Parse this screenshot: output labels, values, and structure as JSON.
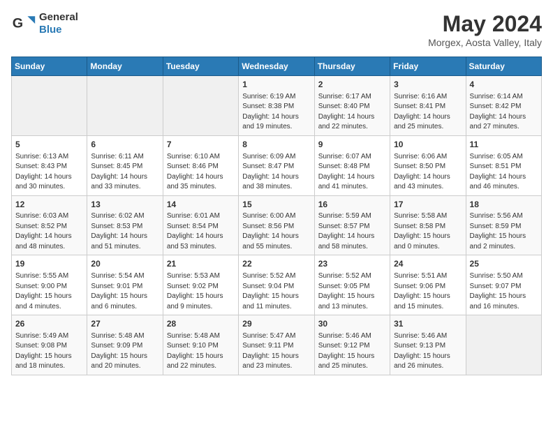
{
  "logo": {
    "line1": "General",
    "line2": "Blue"
  },
  "title": "May 2024",
  "location": "Morgex, Aosta Valley, Italy",
  "days_header": [
    "Sunday",
    "Monday",
    "Tuesday",
    "Wednesday",
    "Thursday",
    "Friday",
    "Saturday"
  ],
  "weeks": [
    [
      {
        "day": "",
        "info": ""
      },
      {
        "day": "",
        "info": ""
      },
      {
        "day": "",
        "info": ""
      },
      {
        "day": "1",
        "info": "Sunrise: 6:19 AM\nSunset: 8:38 PM\nDaylight: 14 hours\nand 19 minutes."
      },
      {
        "day": "2",
        "info": "Sunrise: 6:17 AM\nSunset: 8:40 PM\nDaylight: 14 hours\nand 22 minutes."
      },
      {
        "day": "3",
        "info": "Sunrise: 6:16 AM\nSunset: 8:41 PM\nDaylight: 14 hours\nand 25 minutes."
      },
      {
        "day": "4",
        "info": "Sunrise: 6:14 AM\nSunset: 8:42 PM\nDaylight: 14 hours\nand 27 minutes."
      }
    ],
    [
      {
        "day": "5",
        "info": "Sunrise: 6:13 AM\nSunset: 8:43 PM\nDaylight: 14 hours\nand 30 minutes."
      },
      {
        "day": "6",
        "info": "Sunrise: 6:11 AM\nSunset: 8:45 PM\nDaylight: 14 hours\nand 33 minutes."
      },
      {
        "day": "7",
        "info": "Sunrise: 6:10 AM\nSunset: 8:46 PM\nDaylight: 14 hours\nand 35 minutes."
      },
      {
        "day": "8",
        "info": "Sunrise: 6:09 AM\nSunset: 8:47 PM\nDaylight: 14 hours\nand 38 minutes."
      },
      {
        "day": "9",
        "info": "Sunrise: 6:07 AM\nSunset: 8:48 PM\nDaylight: 14 hours\nand 41 minutes."
      },
      {
        "day": "10",
        "info": "Sunrise: 6:06 AM\nSunset: 8:50 PM\nDaylight: 14 hours\nand 43 minutes."
      },
      {
        "day": "11",
        "info": "Sunrise: 6:05 AM\nSunset: 8:51 PM\nDaylight: 14 hours\nand 46 minutes."
      }
    ],
    [
      {
        "day": "12",
        "info": "Sunrise: 6:03 AM\nSunset: 8:52 PM\nDaylight: 14 hours\nand 48 minutes."
      },
      {
        "day": "13",
        "info": "Sunrise: 6:02 AM\nSunset: 8:53 PM\nDaylight: 14 hours\nand 51 minutes."
      },
      {
        "day": "14",
        "info": "Sunrise: 6:01 AM\nSunset: 8:54 PM\nDaylight: 14 hours\nand 53 minutes."
      },
      {
        "day": "15",
        "info": "Sunrise: 6:00 AM\nSunset: 8:56 PM\nDaylight: 14 hours\nand 55 minutes."
      },
      {
        "day": "16",
        "info": "Sunrise: 5:59 AM\nSunset: 8:57 PM\nDaylight: 14 hours\nand 58 minutes."
      },
      {
        "day": "17",
        "info": "Sunrise: 5:58 AM\nSunset: 8:58 PM\nDaylight: 15 hours\nand 0 minutes."
      },
      {
        "day": "18",
        "info": "Sunrise: 5:56 AM\nSunset: 8:59 PM\nDaylight: 15 hours\nand 2 minutes."
      }
    ],
    [
      {
        "day": "19",
        "info": "Sunrise: 5:55 AM\nSunset: 9:00 PM\nDaylight: 15 hours\nand 4 minutes."
      },
      {
        "day": "20",
        "info": "Sunrise: 5:54 AM\nSunset: 9:01 PM\nDaylight: 15 hours\nand 6 minutes."
      },
      {
        "day": "21",
        "info": "Sunrise: 5:53 AM\nSunset: 9:02 PM\nDaylight: 15 hours\nand 9 minutes."
      },
      {
        "day": "22",
        "info": "Sunrise: 5:52 AM\nSunset: 9:04 PM\nDaylight: 15 hours\nand 11 minutes."
      },
      {
        "day": "23",
        "info": "Sunrise: 5:52 AM\nSunset: 9:05 PM\nDaylight: 15 hours\nand 13 minutes."
      },
      {
        "day": "24",
        "info": "Sunrise: 5:51 AM\nSunset: 9:06 PM\nDaylight: 15 hours\nand 15 minutes."
      },
      {
        "day": "25",
        "info": "Sunrise: 5:50 AM\nSunset: 9:07 PM\nDaylight: 15 hours\nand 16 minutes."
      }
    ],
    [
      {
        "day": "26",
        "info": "Sunrise: 5:49 AM\nSunset: 9:08 PM\nDaylight: 15 hours\nand 18 minutes."
      },
      {
        "day": "27",
        "info": "Sunrise: 5:48 AM\nSunset: 9:09 PM\nDaylight: 15 hours\nand 20 minutes."
      },
      {
        "day": "28",
        "info": "Sunrise: 5:48 AM\nSunset: 9:10 PM\nDaylight: 15 hours\nand 22 minutes."
      },
      {
        "day": "29",
        "info": "Sunrise: 5:47 AM\nSunset: 9:11 PM\nDaylight: 15 hours\nand 23 minutes."
      },
      {
        "day": "30",
        "info": "Sunrise: 5:46 AM\nSunset: 9:12 PM\nDaylight: 15 hours\nand 25 minutes."
      },
      {
        "day": "31",
        "info": "Sunrise: 5:46 AM\nSunset: 9:13 PM\nDaylight: 15 hours\nand 26 minutes."
      },
      {
        "day": "",
        "info": ""
      }
    ]
  ]
}
